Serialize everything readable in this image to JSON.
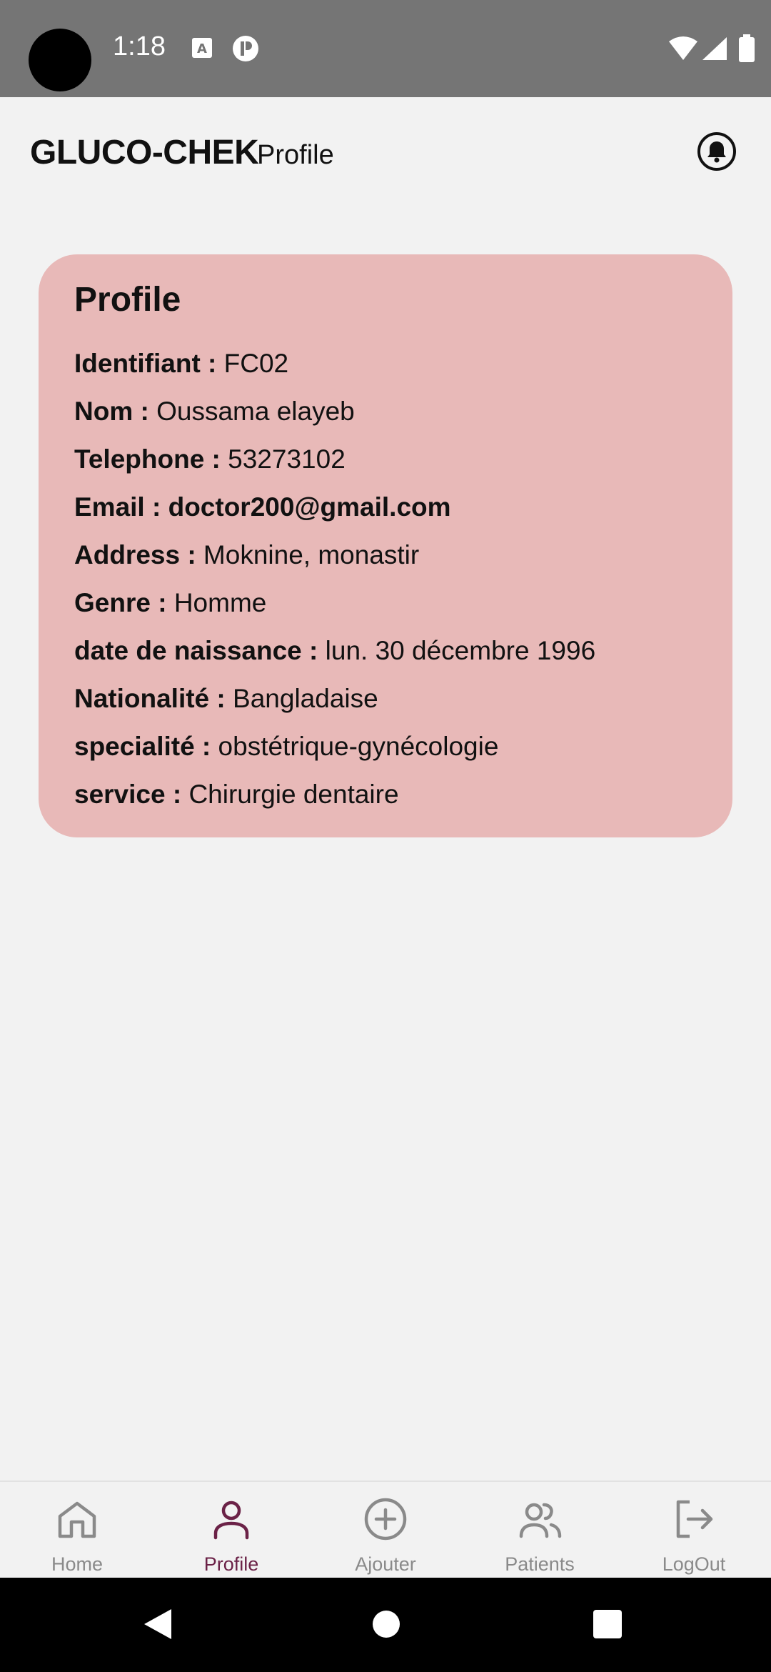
{
  "status_bar": {
    "time": "1:18",
    "icons": [
      "a-icon",
      "p-icon",
      "wifi-icon",
      "signal-icon",
      "battery-icon"
    ]
  },
  "header": {
    "title": "GLUCO-CHEK",
    "subtitle": "Profile",
    "notification_icon": "bell-icon"
  },
  "profile": {
    "title": "Profile",
    "fields": [
      {
        "label": "Identifiant :",
        "value": " FC02"
      },
      {
        "label": "Nom :",
        "value": " Oussama elayeb"
      },
      {
        "label": "Telephone :",
        "value": " 53273102"
      },
      {
        "label": "Email :",
        "value": " doctor200@gmail.com"
      },
      {
        "label": "Address :",
        "value": " Moknine, monastir"
      },
      {
        "label": "Genre :",
        "value": " Homme"
      },
      {
        "label": "date de naissance :",
        "value": " lun. 30 décembre 1996"
      },
      {
        "label": "Nationalité :",
        "value": " Bangladaise"
      },
      {
        "label": "specialité :",
        "value": " obstétrique-gynécologie"
      },
      {
        "label": "service :",
        "value": " Chirurgie dentaire"
      }
    ]
  },
  "bottom_nav": {
    "items": [
      {
        "label": "Home",
        "icon": "home-icon"
      },
      {
        "label": "Profile",
        "icon": "person-icon",
        "active": true
      },
      {
        "label": "Ajouter",
        "icon": "add-circle-icon"
      },
      {
        "label": "Patients",
        "icon": "group-icon"
      },
      {
        "label": "LogOut",
        "icon": "logout-icon"
      }
    ]
  },
  "colors": {
    "card_background": "#e8b9b8",
    "active_nav": "#6b2247",
    "inactive_nav": "#8a8a8a",
    "page_background": "#f2f2f2",
    "status_bar": "#757575"
  }
}
